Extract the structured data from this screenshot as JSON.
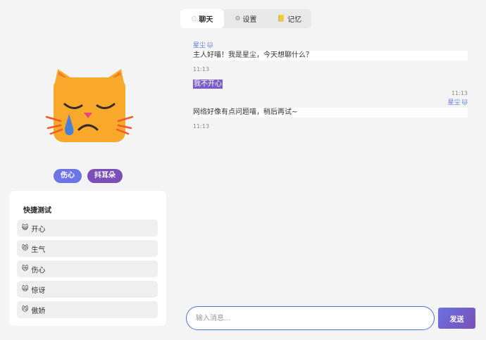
{
  "tabs": {
    "chat": {
      "icon": "◌",
      "label": "聊天"
    },
    "settings": {
      "icon": "⚙",
      "label": "设置"
    },
    "memory": {
      "icon": "📒",
      "label": "记忆"
    }
  },
  "pet": {
    "mood_tags": [
      "伤心",
      "抖耳朵"
    ]
  },
  "quick_test": {
    "title": "快捷测试",
    "items": [
      {
        "emoji": "😺",
        "label": "开心"
      },
      {
        "emoji": "😾",
        "label": "生气"
      },
      {
        "emoji": "😿",
        "label": "伤心"
      },
      {
        "emoji": "🙀",
        "label": "惊讶"
      },
      {
        "emoji": "😼",
        "label": "傲娇"
      }
    ]
  },
  "chat": {
    "messages": [
      {
        "role": "ai",
        "sender": "星尘",
        "emoji": "🐱",
        "text": "主人好喵！我是星尘，今天想聊什么？",
        "time": "11:13"
      },
      {
        "role": "user",
        "text": "我不开心",
        "time": "11:13"
      },
      {
        "role": "ai",
        "sender": "星尘",
        "emoji": "🐱",
        "text": "网络好像有点问题喵，稍后再试~",
        "time": "11:13"
      }
    ]
  },
  "input": {
    "placeholder": "输入消息...",
    "send_label": "发送"
  },
  "colors": {
    "accent": "#6c74e6",
    "accent_purple": "#7a4fb8",
    "cat_orange": "#f9a92a"
  }
}
